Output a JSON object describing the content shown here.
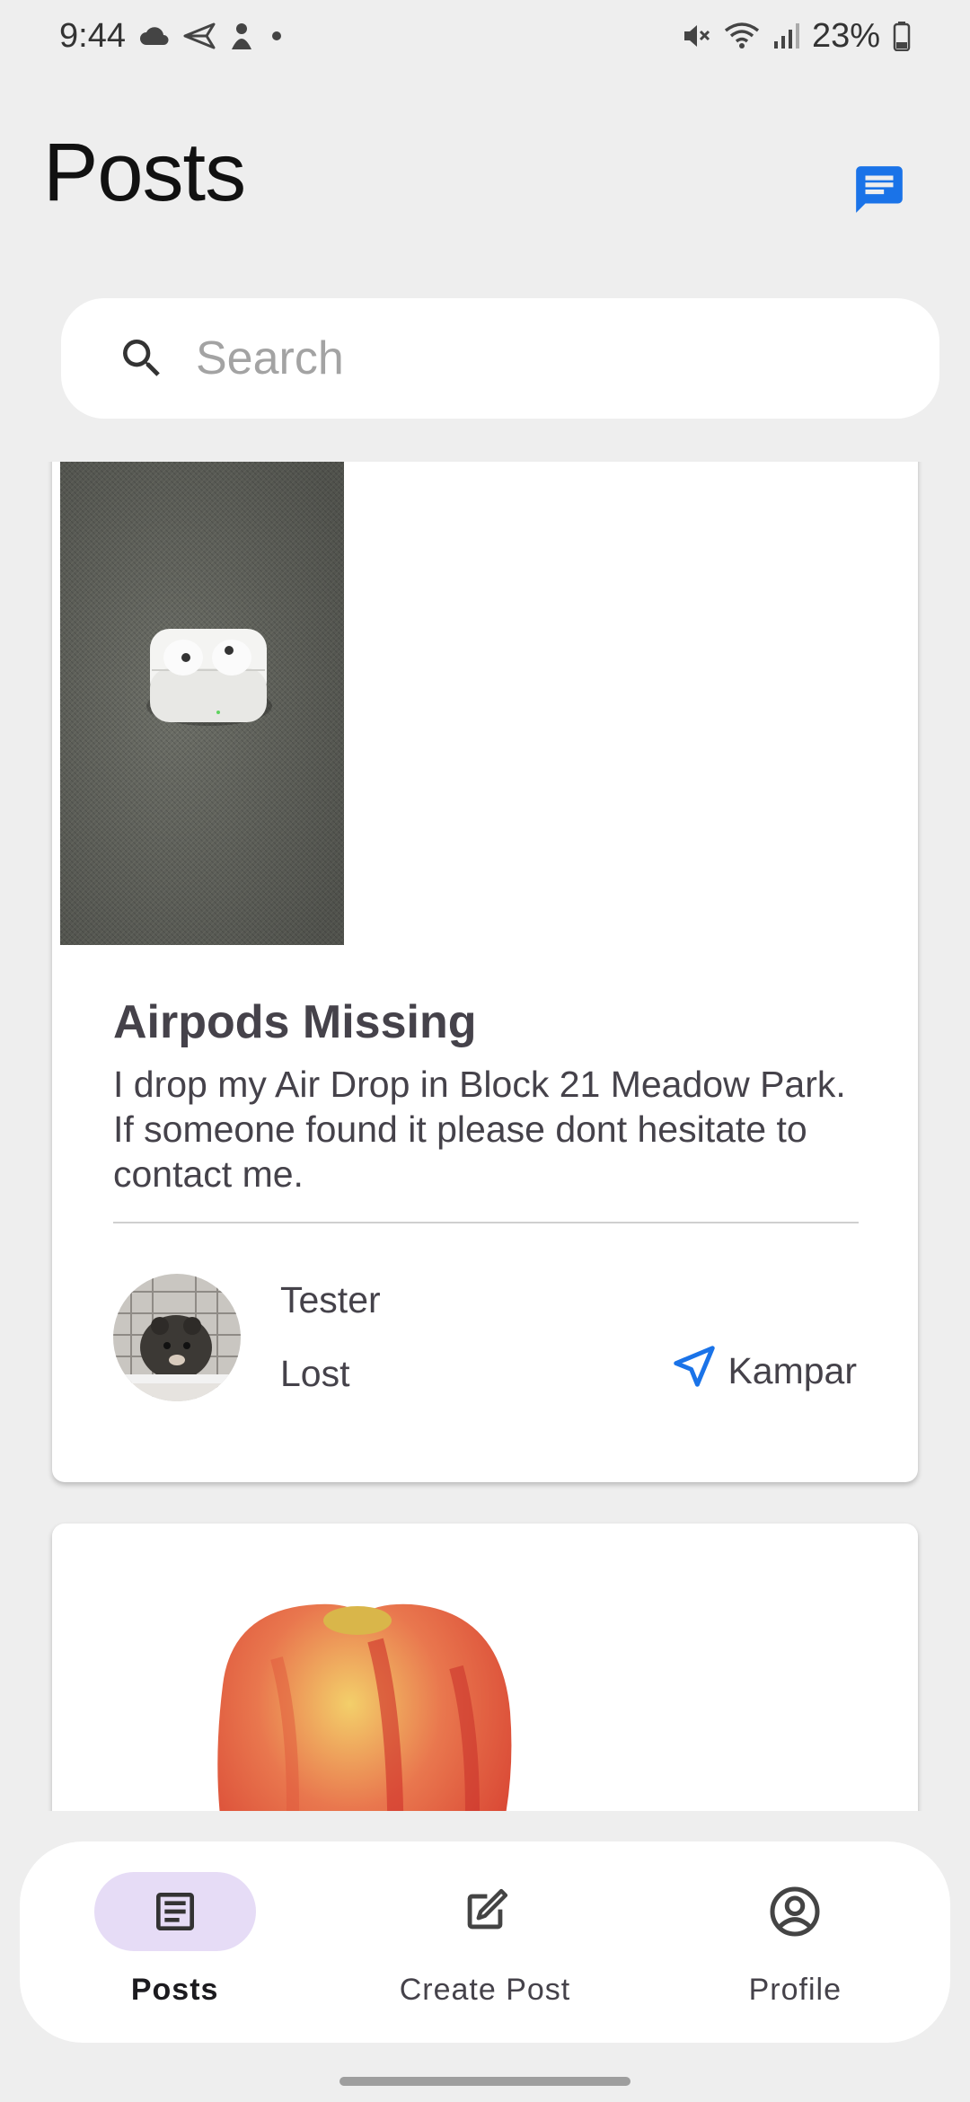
{
  "status_bar": {
    "time": "9:44",
    "battery": "23%",
    "left_icons": [
      "cloud-icon",
      "send-icon",
      "pet-icon",
      "dot-icon"
    ],
    "right_icons": [
      "mute-icon",
      "wifi-icon",
      "signal-icon",
      "battery-icon"
    ]
  },
  "header": {
    "title": "Posts",
    "chat_icon": "chat-icon",
    "accent": "#1a73e8"
  },
  "search": {
    "placeholder": "Search",
    "value": ""
  },
  "posts": [
    {
      "image": "airpods-photo",
      "title": "Airpods Missing",
      "description": "I drop my Air Drop in Block 21 Meadow Park. If someone found it please dont hesitate to contact me.",
      "author": "Tester",
      "status": "Lost",
      "location": "Kampar",
      "avatar": "hamster-avatar"
    },
    {
      "image": "apple-photo"
    }
  ],
  "bottom_nav": {
    "items": [
      {
        "label": "Posts",
        "icon": "article-icon",
        "active": true
      },
      {
        "label": "Create Post",
        "icon": "edit-icon",
        "active": false
      },
      {
        "label": "Profile",
        "icon": "account-icon",
        "active": false
      }
    ],
    "active_indicator_color": "#e6dcf6"
  }
}
